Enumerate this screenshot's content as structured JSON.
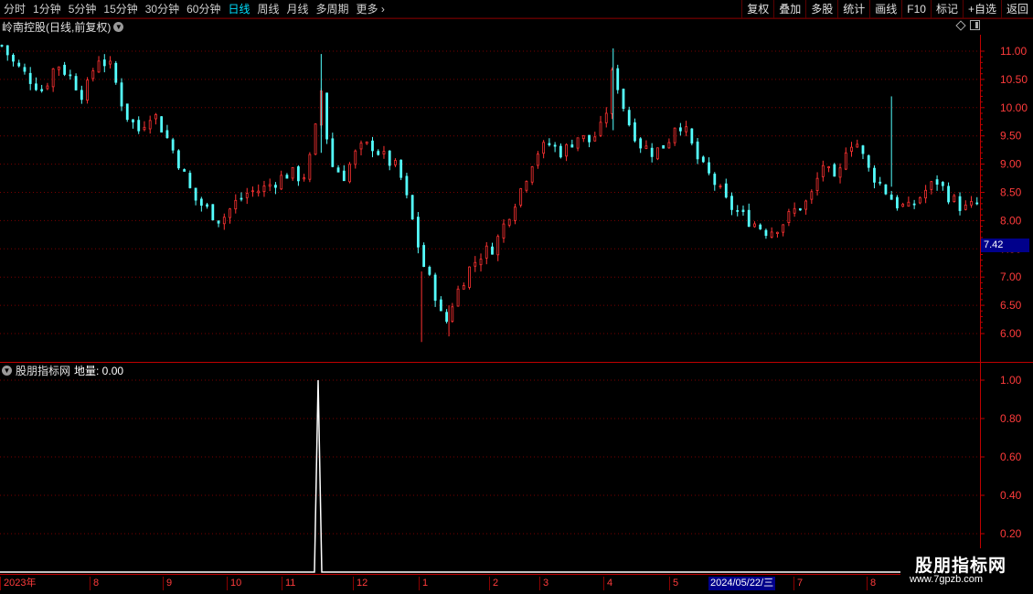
{
  "toolbar": {
    "periods": [
      "分时",
      "1分钟",
      "5分钟",
      "15分钟",
      "30分钟",
      "60分钟",
      "日线",
      "周线",
      "月线",
      "多周期",
      "更多"
    ],
    "active_period": "日线",
    "buttons": [
      "复权",
      "叠加",
      "多股",
      "统计",
      "画线",
      "F10",
      "标记",
      "+自选",
      "返回"
    ]
  },
  "chart_title": "岭南控股(日线,前复权)",
  "indicator": {
    "name": "股朋指标网",
    "label": "地量: 0.00"
  },
  "current_price_tag": "7.42",
  "cursor_date": "2024/05/22/三",
  "date_labels": [
    "2023年",
    "8",
    "9",
    "10",
    "11",
    "12",
    "1",
    "2",
    "3",
    "4",
    "5",
    "7",
    "8"
  ],
  "watermark": {
    "title": "股朋指标网",
    "url": "www.7gpzb.com"
  },
  "colors": {
    "up": "#ff3232",
    "down": "#54ffff",
    "grid": "#7a0000",
    "axis": "#c00000",
    "price_tag_bg": "#00008b",
    "active_tab": "#00e0ff"
  },
  "chart_data": [
    {
      "type": "candlestick",
      "title": "岭南控股(日线,前复权)",
      "y_ticks": [
        11.0,
        10.5,
        10.0,
        9.5,
        9.0,
        8.5,
        8.0,
        7.5,
        7.0,
        6.5,
        6.0
      ],
      "ylim": [
        5.7,
        11.4
      ],
      "current_price": 7.42,
      "x_labels": [
        "2023年",
        "8",
        "9",
        "10",
        "11",
        "12",
        "1",
        "2",
        "3",
        "4",
        "5",
        "2024/05/22/三",
        "7",
        "8"
      ],
      "close_path": [
        [
          0,
          11.1
        ],
        [
          5,
          10.8
        ],
        [
          10,
          10.6
        ],
        [
          18,
          10.3
        ],
        [
          24,
          10.8
        ],
        [
          30,
          10.55
        ],
        [
          36,
          10.2
        ],
        [
          42,
          10.9
        ],
        [
          48,
          10.7
        ],
        [
          54,
          9.9
        ],
        [
          60,
          9.6
        ],
        [
          66,
          9.95
        ],
        [
          72,
          9.5
        ],
        [
          78,
          9.0
        ],
        [
          84,
          8.4
        ],
        [
          90,
          8.2
        ],
        [
          96,
          8.0
        ],
        [
          102,
          8.3
        ],
        [
          108,
          8.5
        ],
        [
          114,
          8.55
        ],
        [
          120,
          8.7
        ],
        [
          126,
          8.85
        ],
        [
          132,
          8.75
        ],
        [
          136,
          9.2
        ],
        [
          140,
          10.3
        ],
        [
          144,
          9.0
        ],
        [
          150,
          8.8
        ],
        [
          156,
          9.25
        ],
        [
          162,
          9.35
        ],
        [
          168,
          9.1
        ],
        [
          174,
          8.9
        ],
        [
          180,
          8.0
        ],
        [
          184,
          7.3
        ],
        [
          190,
          6.7
        ],
        [
          194,
          6.1
        ],
        [
          198,
          6.6
        ],
        [
          204,
          7.1
        ],
        [
          210,
          7.4
        ],
        [
          216,
          7.55
        ],
        [
          222,
          8.1
        ],
        [
          228,
          8.6
        ],
        [
          234,
          9.2
        ],
        [
          240,
          9.35
        ],
        [
          246,
          9.2
        ],
        [
          252,
          9.5
        ],
        [
          258,
          9.4
        ],
        [
          264,
          9.7
        ],
        [
          268,
          10.7
        ],
        [
          274,
          9.8
        ],
        [
          280,
          9.35
        ],
        [
          286,
          9.2
        ],
        [
          292,
          9.4
        ],
        [
          296,
          9.8
        ],
        [
          300,
          9.55
        ],
        [
          306,
          9.0
        ],
        [
          312,
          8.7
        ],
        [
          318,
          8.3
        ],
        [
          324,
          8.1
        ],
        [
          330,
          7.95
        ],
        [
          336,
          7.8
        ],
        [
          342,
          7.95
        ],
        [
          348,
          8.2
        ],
        [
          354,
          8.35
        ],
        [
          360,
          9.0
        ],
        [
          366,
          8.6
        ],
        [
          370,
          9.3
        ],
        [
          374,
          9.45
        ],
        [
          380,
          8.9
        ],
        [
          386,
          8.6
        ],
        [
          392,
          8.3
        ],
        [
          398,
          8.2
        ],
        [
          404,
          8.5
        ],
        [
          410,
          8.7
        ],
        [
          416,
          8.4
        ],
        [
          422,
          8.2
        ],
        [
          428,
          8.3
        ]
      ]
    },
    {
      "type": "line",
      "series": [
        {
          "name": "地量",
          "values": [
            {
              "x": "2023-11",
              "y": 1.0
            }
          ]
        }
      ],
      "baseline": 0.0,
      "y_ticks": [
        1.0,
        0.8,
        0.6,
        0.4,
        0.2
      ],
      "ylim": [
        0.0,
        1.04
      ],
      "current_value": 0.0
    }
  ]
}
